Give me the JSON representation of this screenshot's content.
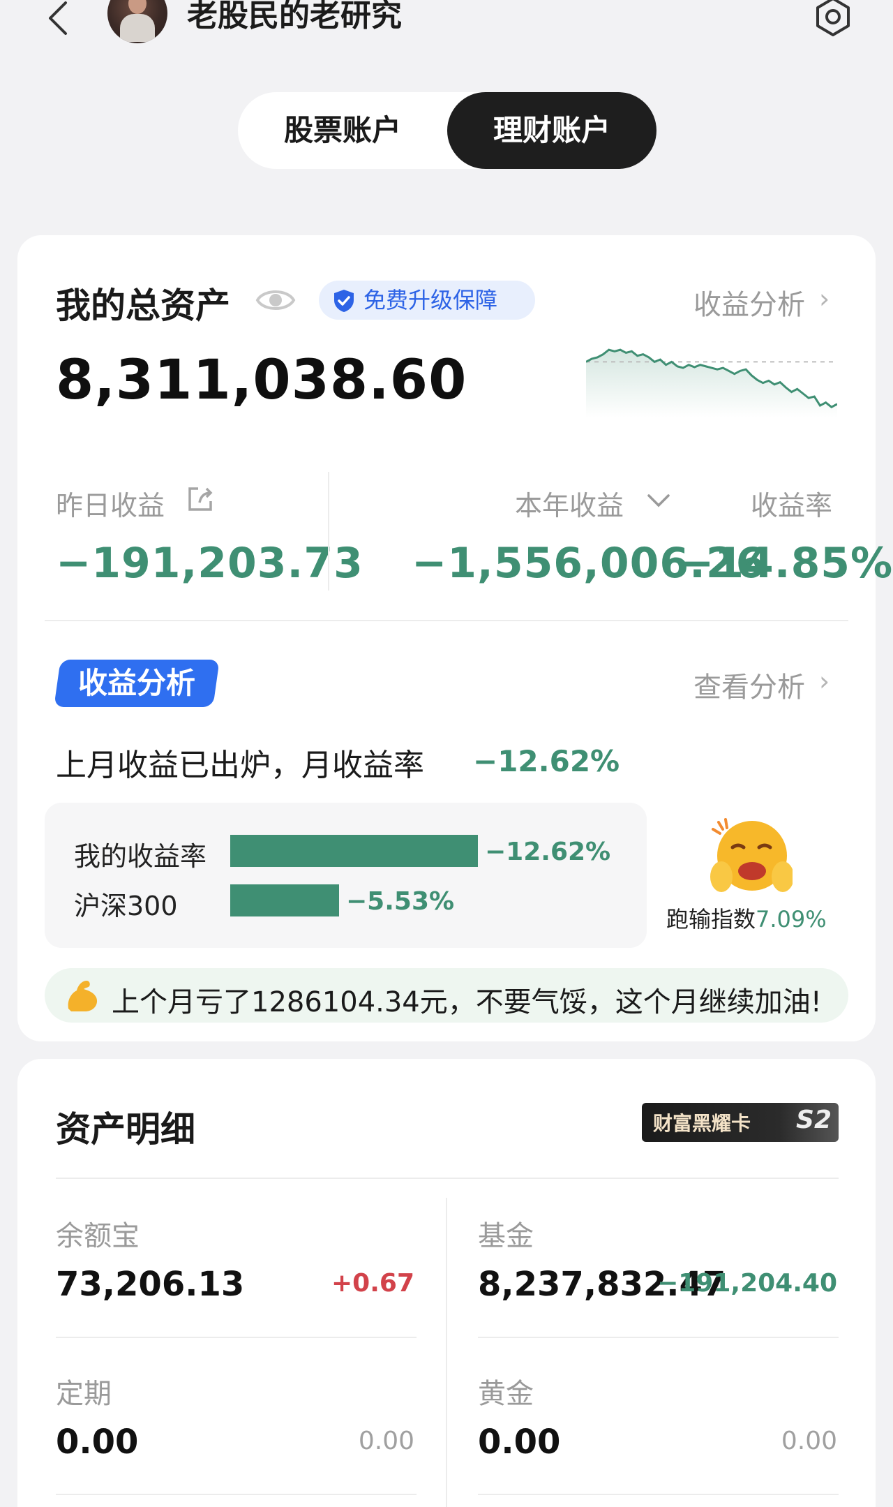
{
  "header": {
    "title": "老股民的老研究",
    "back_icon": "chevron-left-icon",
    "settings_icon": "gear-icon"
  },
  "tabs": [
    {
      "label": "股票账户",
      "active": false
    },
    {
      "label": "理财账户",
      "active": true
    }
  ],
  "total_assets": {
    "title": "我的总资产",
    "badge": "免费升级保障",
    "analysis_link": "收益分析",
    "amount": "8,311,038.60",
    "trend": [
      0.7,
      0.74,
      0.76,
      0.8,
      0.86,
      0.84,
      0.86,
      0.82,
      0.84,
      0.78,
      0.8,
      0.76,
      0.7,
      0.73,
      0.66,
      0.7,
      0.64,
      0.62,
      0.66,
      0.63,
      0.66,
      0.64,
      0.62,
      0.6,
      0.62,
      0.58,
      0.54,
      0.58,
      0.6,
      0.52,
      0.46,
      0.42,
      0.45,
      0.4,
      0.43,
      0.36,
      0.3,
      0.34,
      0.28,
      0.22,
      0.24,
      0.12,
      0.16,
      0.1,
      0.14
    ]
  },
  "earnings": {
    "yesterday_label": "昨日收益",
    "yesterday_value": "−191,203.73",
    "year_label": "本年收益",
    "year_value": "−1,556,006.26",
    "rate_label": "收益率",
    "rate_value": "−14.85%"
  },
  "analysis": {
    "tag": "收益分析",
    "view_link": "查看分析",
    "message": "上月收益已出炉，月收益率",
    "monthly_rate": "−12.62%",
    "compare": [
      {
        "label": "我的收益率",
        "value": "−12.62%",
        "magnitude": 12.62
      },
      {
        "label": "沪深300",
        "value": "−5.53%",
        "magnitude": 5.53
      }
    ],
    "lose_label": "跑输指数",
    "lose_value": "7.09%",
    "tip": "上个月亏了1286104.34元，不要气馁，这个月继续加油!"
  },
  "assets_detail": {
    "title": "资产明细",
    "vip_label": "财富黑耀卡",
    "vip_tier": "S2",
    "items": [
      {
        "name": "余额宝",
        "amount": "73,206.13",
        "change": "+0.67",
        "tone": "red"
      },
      {
        "name": "基金",
        "amount": "8,237,832.47",
        "change": "−191,204.40",
        "tone": "green"
      },
      {
        "name": "定期",
        "amount": "0.00",
        "change": "0.00",
        "tone": "gray"
      },
      {
        "name": "黄金",
        "amount": "0.00",
        "change": "0.00",
        "tone": "gray"
      }
    ]
  },
  "colors": {
    "loss_green": "#3f8f73",
    "gain_red": "#d2424a",
    "accent_blue": "#2f6ff0"
  }
}
